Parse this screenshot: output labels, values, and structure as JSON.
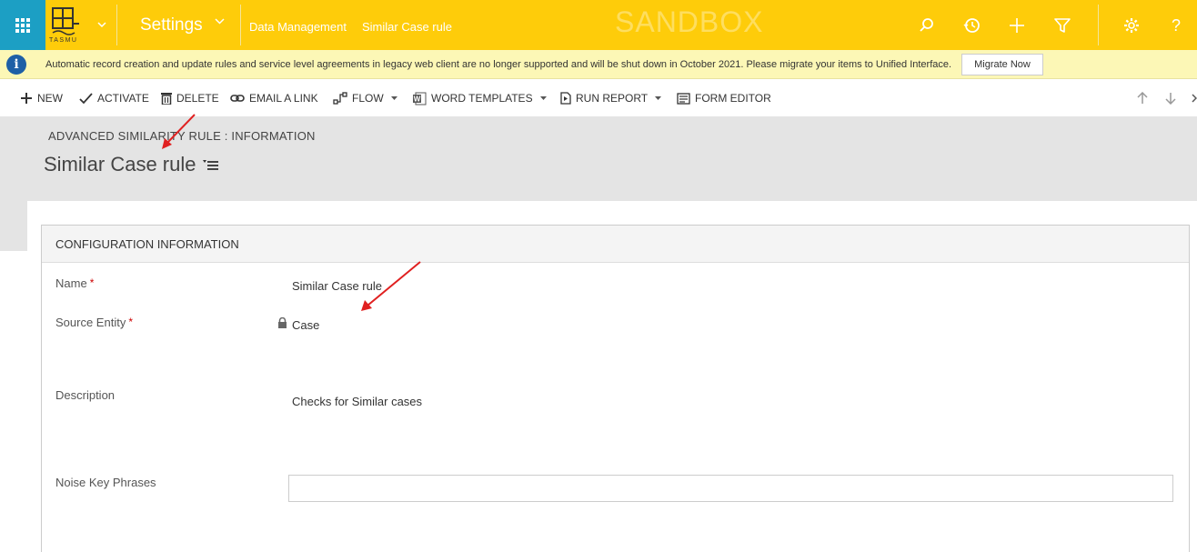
{
  "nav": {
    "logo_caption": "TASMU",
    "app_title": "Settings",
    "breadcrumbs": [
      "Data Management",
      "Similar Case rule"
    ],
    "watermark": "SANDBOX",
    "icons": [
      "search-icon",
      "recent-icon",
      "plus-icon",
      "filter-icon",
      "gear-icon",
      "help-icon"
    ],
    "help_label": "?"
  },
  "notification": {
    "message": "Automatic record creation and update rules and service level agreements in legacy web client are no longer supported and will be shut down in October 2021. Please migrate your items to Unified Interface.",
    "button_label": "Migrate Now"
  },
  "commands": [
    {
      "label": "NEW",
      "icon": "plus-icon"
    },
    {
      "label": "ACTIVATE",
      "icon": "check-icon"
    },
    {
      "label": "DELETE",
      "icon": "trash-icon"
    },
    {
      "label": "EMAIL A LINK",
      "icon": "link-icon"
    },
    {
      "label": "FLOW",
      "icon": "flow-icon"
    },
    {
      "label": "WORD TEMPLATES",
      "icon": "word-icon"
    },
    {
      "label": "RUN REPORT",
      "icon": "report-icon"
    },
    {
      "label": "FORM EDITOR",
      "icon": "form-icon"
    }
  ],
  "header": {
    "entity_title": "ADVANCED SIMILARITY RULE : INFORMATION",
    "record_title": "Similar Case rule"
  },
  "form": {
    "section_title": "CONFIGURATION INFORMATION",
    "fields": {
      "name": {
        "label": "Name",
        "value": "Similar Case rule",
        "required": "*"
      },
      "source_entity": {
        "label": "Source Entity",
        "value": "Case",
        "required": "*"
      },
      "description": {
        "label": "Description",
        "value": "Checks for Similar cases"
      },
      "noise_key_phrases": {
        "label": "Noise Key Phrases",
        "value": ""
      }
    }
  },
  "colors": {
    "nav_bar": "#fecc0a",
    "waffle": "#1c9fc4",
    "notification": "#fcf7b6",
    "header_band": "#e4e4e4",
    "annotation_arrow": "#e02020"
  }
}
